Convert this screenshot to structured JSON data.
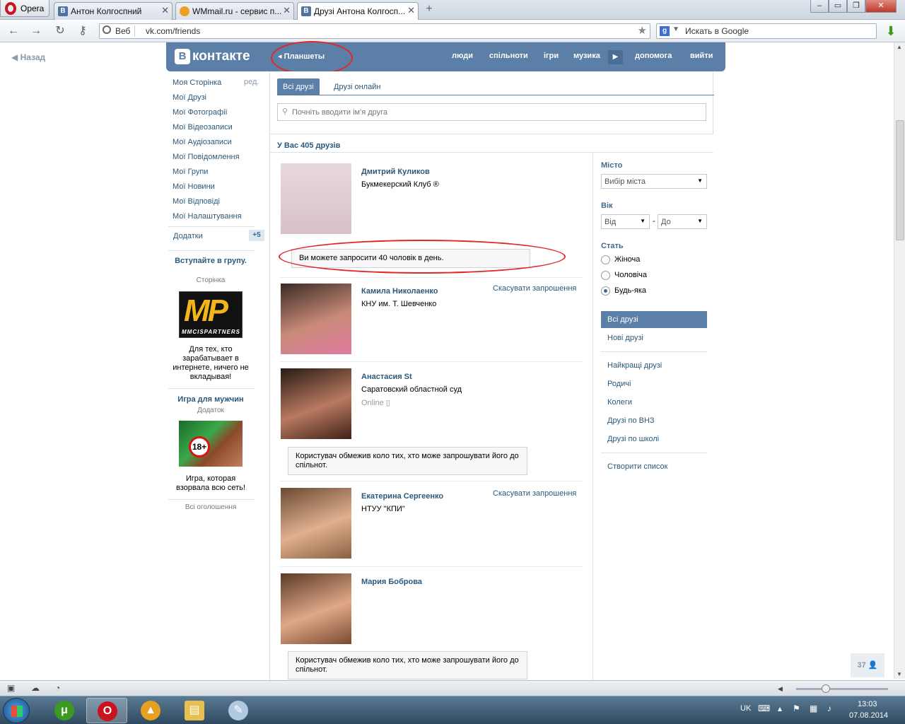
{
  "browser": {
    "menu_label": "Opera",
    "tabs": [
      {
        "title": "Антон Колгоспний",
        "icon": "В"
      },
      {
        "title": "WMmail.ru - сервис п...",
        "icon": ""
      },
      {
        "title": "Друзі Антона Колгосп...",
        "icon": "В"
      }
    ],
    "address_badge": "Веб",
    "url": "vk.com/friends",
    "search_placeholder": "Искать в Google"
  },
  "page": {
    "back_label": "Назад",
    "logo_letter": "В",
    "logo_text": "контакте",
    "tablets_label": "Планшеты",
    "top_nav": [
      "люди",
      "спільноти",
      "ігри",
      "музика",
      "допомога",
      "вийти"
    ]
  },
  "left_menu": {
    "items": [
      "Моя Сторінка",
      "Мої Друзі",
      "Мої Фотографії",
      "Мої Відеозаписи",
      "Мої Аудіозаписи",
      "Мої Повідомлення",
      "Мої Групи",
      "Мої Новини",
      "Мої Відповіді",
      "Мої Налаштування"
    ],
    "edit_label": "ред.",
    "apps_label": "Додатки",
    "apps_count": "+5",
    "ad1": {
      "title": "Вступайте в групу.",
      "subtitle": "Сторінка",
      "logo_text": "MP",
      "logo_sub": "MMCISPARTNERS",
      "text": "Для тех, кто зарабатывает в интернете, ничего не вкладывая!"
    },
    "ad2": {
      "title": "Игра для мужчин",
      "subtitle": "Додаток",
      "badge": "18+",
      "text": "Игра, которая взорвала всю сеть!"
    },
    "all_ads": "Всі оголошення"
  },
  "main": {
    "tabs": [
      "Всі друзі",
      "Друзі онлайн"
    ],
    "search_placeholder": "Почніть вводити ім'я друга",
    "count_label": "У Вас 405 друзів",
    "friends": [
      {
        "name": "Дмитрий Куликов",
        "info": "Букмекерский Клуб ®",
        "notice": "Ви можете запросити 40 чоловік в день."
      },
      {
        "name": "Камила Николаенко",
        "info": "КНУ им. Т. Шевченко",
        "cancel": "Скасувати запрошення"
      },
      {
        "name": "Анастасия St",
        "info": "Саратовский областной суд",
        "online": "Online",
        "notice": "Користувач обмежив коло тих, хто може запрошувати його до спільнот."
      },
      {
        "name": "Екатерина Сергеенко",
        "info": "НТУУ \"КПИ\"",
        "cancel": "Скасувати запрошення"
      },
      {
        "name": "Мария Боброва",
        "notice": "Користувач обмежив коло тих, хто може запрошувати його до спільнот."
      }
    ]
  },
  "filter": {
    "city_label": "Місто",
    "city_value": "Вибір міста",
    "age_label": "Вік",
    "age_from": "Від",
    "age_dash": "-",
    "age_to": "До",
    "sex_label": "Стать",
    "sex_options": [
      "Жіноча",
      "Чоловіча",
      "Будь-яка"
    ],
    "nav": [
      "Всі друзі",
      "Нові друзі",
      "Найкращі друзі",
      "Родичі",
      "Колеги",
      "Друзі по ВНЗ",
      "Друзі по школі",
      "Створити список"
    ]
  },
  "counter": "37",
  "taskbar": {
    "lang": "UK",
    "time": "13:03",
    "date": "07.08.2014"
  }
}
